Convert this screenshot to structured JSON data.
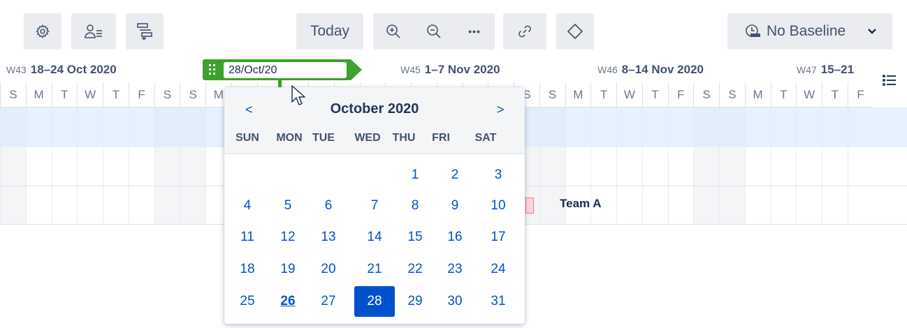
{
  "toolbar": {
    "settings_icon": "gear-icon",
    "resources_icon": "user-list-icon",
    "auto_schedule_icon": "auto-schedule-icon",
    "today_label": "Today",
    "zoom_in_icon": "zoom-in-icon",
    "zoom_out_icon": "zoom-out-icon",
    "more_label": "•••",
    "link_icon": "link-icon",
    "milestone_icon": "diamond-icon",
    "baseline_label": "No Baseline",
    "baseline_icon": "baseline-icon",
    "baseline_caret": "chevron-down-icon"
  },
  "timeline": {
    "weeks": [
      {
        "num": "W43",
        "range": "18–24 Oct 2020"
      },
      {
        "num": "W45",
        "range": "1–7 Nov 2020"
      },
      {
        "num": "W46",
        "range": "8–14 Nov 2020"
      },
      {
        "num": "W47",
        "range": "15–21"
      }
    ],
    "day_letters": [
      "S",
      "M",
      "T",
      "W",
      "T",
      "F",
      "S",
      "S",
      "M",
      "T",
      "W",
      "T",
      "F",
      "S",
      "S",
      "M",
      "T",
      "W",
      "T",
      "F",
      "S",
      "S",
      "M",
      "T",
      "W",
      "T",
      "F",
      "S",
      "S",
      "M",
      "T",
      "W",
      "T",
      "F"
    ],
    "list_icon": "list-icon"
  },
  "marker": {
    "date_value": "28/Oct/20",
    "handle_icon": "drag-handle-icon",
    "color": "#3da12d"
  },
  "rows": {
    "team_label": "Team A"
  },
  "calendar": {
    "prev": "<",
    "next": ">",
    "title": "October 2020",
    "weekdays": [
      "SUN",
      "MON",
      "TUE",
      "WED",
      "THU",
      "FRI",
      "SAT"
    ],
    "weeks": [
      [
        "",
        "",
        "",
        "",
        "1",
        "2",
        "3"
      ],
      [
        "4",
        "5",
        "6",
        "7",
        "8",
        "9",
        "10"
      ],
      [
        "11",
        "12",
        "13",
        "14",
        "15",
        "16",
        "17"
      ],
      [
        "18",
        "19",
        "20",
        "21",
        "22",
        "23",
        "24"
      ],
      [
        "25",
        "26",
        "27",
        "28",
        "29",
        "30",
        "31"
      ]
    ],
    "today": "26",
    "selected": "28",
    "accent": "#0052cc"
  }
}
